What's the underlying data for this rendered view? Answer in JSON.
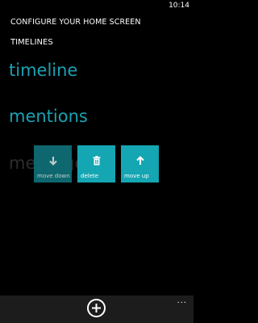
{
  "status_bar": {
    "time": "10:14"
  },
  "header": {
    "title": "CONFIGURE YOUR HOME SCREEN",
    "section": "TIMELINES"
  },
  "timelines": [
    {
      "label": "timeline"
    },
    {
      "label": "mentions"
    },
    {
      "label": "messages",
      "dimmed": true
    }
  ],
  "actions": [
    {
      "label": "move down",
      "icon": "arrow-down-icon"
    },
    {
      "label": "delete",
      "icon": "trash-icon"
    },
    {
      "label": "move up",
      "icon": "arrow-up-icon"
    }
  ],
  "app_bar": {
    "add_icon": "add-circle-icon",
    "more_label": "..."
  },
  "colors": {
    "accent": "#14a6b2",
    "accent_text": "#1aa1b3",
    "background": "#000000",
    "app_bar": "#1c1c1c"
  }
}
